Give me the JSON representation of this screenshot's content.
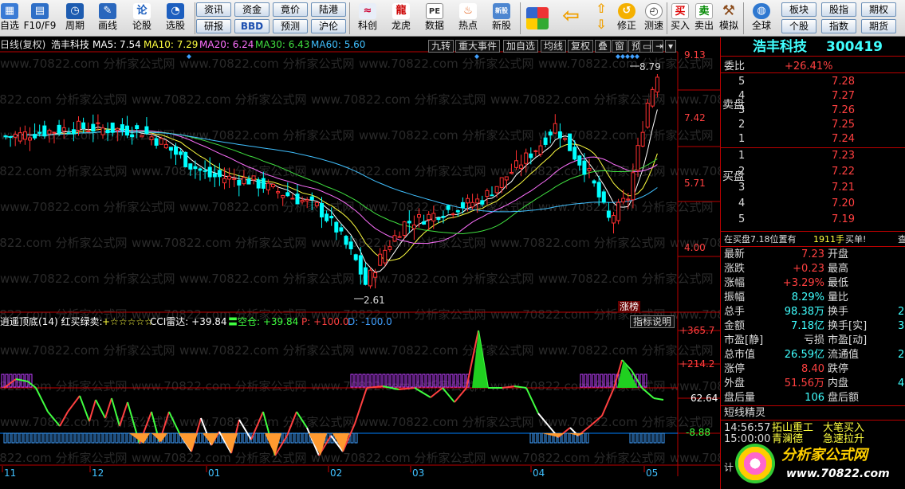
{
  "toolbar": {
    "b_zixuan": "自选",
    "b_f10": "F10/F9",
    "b_zhouqi": "周期",
    "b_huaxian": "画线",
    "b_lungu": "论股",
    "b_xuangu": "选股",
    "s_zixun": "资讯",
    "s_zijin": "资金",
    "s_jingjia": "竟价",
    "s_lugang": "陆港",
    "s_yanbao": "研报",
    "s_bbd": "BBD",
    "s_yuce": "预测",
    "s_hulun": "沪伦",
    "b_kechuang": "科创",
    "b_longhu": "龙虎",
    "b_shuju": "数据",
    "b_redian": "热点",
    "b_xingu": "新股",
    "b_xiufu": "修正",
    "b_celiu": "测速",
    "b_mairu": "买入",
    "b_maichu": "卖出",
    "b_moni": "模拟",
    "b_quanqiu": "全球",
    "s_bankuai": "板块",
    "s_guben": "股指",
    "s_qihuo": "期权",
    "s_geguxiang": "个股",
    "s_zhishu": "指数",
    "s_qihuo2": "期货",
    "pe_label": "PE",
    "mini_label": "新股"
  },
  "chart": {
    "title_period": "日线(复权)",
    "stock_name": "浩丰科技",
    "ma5": "MA5: 7.54",
    "ma10": "MA10: 7.29",
    "ma20": "MA20: 6.24",
    "ma30": "MA30: 6.43",
    "ma60": "MA60: 5.60",
    "buttons": [
      "九转",
      "重大事件",
      "加自选",
      "均线",
      "复权",
      "叠",
      "窗",
      "预测"
    ],
    "y_ticks": [
      "9.13",
      "7.42",
      "5.71",
      "4.00"
    ],
    "max_label": "8.79",
    "min_label": "2.61",
    "zhangbang": "涨榜",
    "ind_name": "逍遥顶底(14) 红买绿卖: ",
    "ind_stars": "+☆☆☆☆☆",
    "ind_cci": "CCI雷达: +39.84",
    "ind_kong": "〓空仓: +39.84",
    "ind_p": "P: +100.0",
    "ind_d": "D: -100.0",
    "ind_btn": "指标说明",
    "ind_ticks": [
      "+365.7",
      "+214.2",
      "62.64",
      "-8.88"
    ],
    "x_ticks": [
      {
        "t": "11",
        "x": 3
      },
      {
        "t": "12",
        "x": 113
      },
      {
        "t": "01",
        "x": 259
      },
      {
        "t": "02",
        "x": 412
      },
      {
        "t": "03",
        "x": 515
      },
      {
        "t": "04",
        "x": 666
      },
      {
        "t": "05",
        "x": 808
      }
    ],
    "watermark": "www.70822.com 分析家公式网"
  },
  "quote": {
    "name": "浩丰科技",
    "code": "300419",
    "weibi_label": "委比",
    "weibi_val": "+26.41%",
    "sell_label": "卖盘",
    "buy_label": "买盘",
    "asks": [
      {
        "n": "5",
        "p": "7.28"
      },
      {
        "n": "4",
        "p": "7.27"
      },
      {
        "n": "3",
        "p": "7.26"
      },
      {
        "n": "2",
        "p": "7.25"
      },
      {
        "n": "1",
        "p": "7.24"
      }
    ],
    "bids": [
      {
        "n": "1",
        "p": "7.23"
      },
      {
        "n": "2",
        "p": "7.22"
      },
      {
        "n": "3",
        "p": "7.21"
      },
      {
        "n": "4",
        "p": "7.20"
      },
      {
        "n": "5",
        "p": "7.19"
      }
    ],
    "zaimai": "在买盘7.18位置有",
    "zaimai_val": "1911手",
    "zaimai_tag": "买单!",
    "zaimai_tail": "查",
    "rows": [
      {
        "l": "最新",
        "v": "7.23",
        "vc": "red",
        "r": "开盘",
        "rv": ""
      },
      {
        "l": "涨跌",
        "v": "+0.23",
        "vc": "red",
        "r": "最高",
        "rv": ""
      },
      {
        "l": "涨幅",
        "v": "+3.29%",
        "vc": "red",
        "r": "最低",
        "rv": ""
      },
      {
        "l": "振幅",
        "v": "8.29%",
        "vc": "cyn",
        "r": "量比",
        "rv": ""
      },
      {
        "l": "总手",
        "v": "98.38万",
        "vc": "cyn",
        "r": "换手",
        "rv": "2"
      },
      {
        "l": "金额",
        "v": "7.18亿",
        "vc": "cyn",
        "r": "换手[实]",
        "rv": "3"
      },
      {
        "l": "市盈[静]",
        "v": "亏损",
        "vc": "wht",
        "r": "市盈[动]",
        "rv": ""
      },
      {
        "l": "总市值",
        "v": "26.59亿",
        "vc": "cyn",
        "r": "流通值",
        "rv": "26"
      },
      {
        "l": "涨停",
        "v": "8.40",
        "vc": "red",
        "r": "跌停",
        "rv": ""
      },
      {
        "l": "外盘",
        "v": "51.56万",
        "vc": "red",
        "r": "内盘",
        "rv": "46"
      },
      {
        "l": "盘后量",
        "v": "106",
        "vc": "cyn",
        "r": "盘后额",
        "rv": ""
      }
    ],
    "short_title": "短线精灵",
    "short_rows": [
      {
        "t": "14:56:57",
        "s": "拓山重工",
        "e": "大笔买入"
      },
      {
        "t": "15:00:00",
        "s": "青澜德",
        "e": "急速拉升"
      }
    ],
    "tail": "计",
    "logo_text": "分析家公式网",
    "logo_url": "www.70822.com"
  },
  "colors": {
    "up": "#ff3030",
    "down": "#00ffff",
    "accent": "#ff0000"
  }
}
